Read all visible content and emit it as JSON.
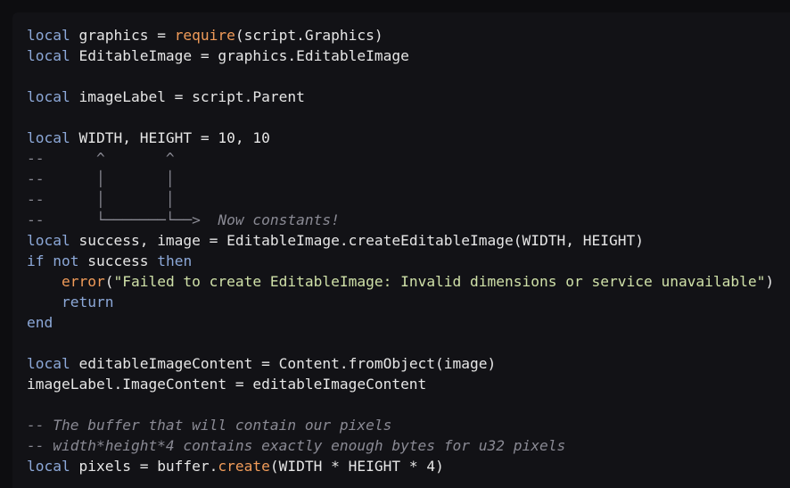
{
  "colors": {
    "background": "#0d0d10",
    "editor_background": "#121216",
    "text": "#e6e6e6",
    "keyword": "#8ca8d8",
    "function": "#f09b59",
    "string": "#cfe0a8",
    "comment": "#8a8a94"
  },
  "lines": [
    [
      [
        "kw",
        "local"
      ],
      [
        "id",
        " graphics = "
      ],
      [
        "fn",
        "require"
      ],
      [
        "id",
        "(script.Graphics)"
      ]
    ],
    [
      [
        "kw",
        "local"
      ],
      [
        "id",
        " EditableImage = graphics.EditableImage"
      ]
    ],
    [],
    [
      [
        "kw",
        "local"
      ],
      [
        "id",
        " imageLabel = script.Parent"
      ]
    ],
    [],
    [
      [
        "kw",
        "local"
      ],
      [
        "id",
        " WIDTH, HEIGHT = 10, 10"
      ]
    ],
    [
      [
        "cm",
        "--      ^       ^"
      ]
    ],
    [
      [
        "cm",
        "--      │       │"
      ]
    ],
    [
      [
        "cm",
        "--      │       │"
      ]
    ],
    [
      [
        "cm",
        "--      └───────└──>  "
      ],
      [
        "cmi",
        "Now constants!"
      ]
    ],
    [
      [
        "kw",
        "local"
      ],
      [
        "id",
        " success, image = EditableImage.createEditableImage(WIDTH, HEIGHT)"
      ]
    ],
    [
      [
        "kw",
        "if"
      ],
      [
        "id",
        " "
      ],
      [
        "kw",
        "not"
      ],
      [
        "id",
        " success "
      ],
      [
        "kw",
        "then"
      ]
    ],
    [
      [
        "id",
        "    "
      ],
      [
        "fn",
        "error"
      ],
      [
        "id",
        "("
      ],
      [
        "str",
        "\"Failed to create EditableImage: Invalid dimensions or service unavailable\""
      ],
      [
        "id",
        ")"
      ]
    ],
    [
      [
        "id",
        "    "
      ],
      [
        "kw",
        "return"
      ]
    ],
    [
      [
        "kw",
        "end"
      ]
    ],
    [],
    [
      [
        "kw",
        "local"
      ],
      [
        "id",
        " editableImageContent = Content.fromObject(image)"
      ]
    ],
    [
      [
        "id",
        "imageLabel.ImageContent = editableImageContent"
      ]
    ],
    [],
    [
      [
        "cmi",
        "-- The buffer that will contain our pixels"
      ]
    ],
    [
      [
        "cmi",
        "-- width*height*4 contains exactly enough bytes for u32 pixels"
      ]
    ],
    [
      [
        "kw",
        "local"
      ],
      [
        "id",
        " pixels = buffer."
      ],
      [
        "fn",
        "create"
      ],
      [
        "id",
        "(WIDTH * HEIGHT * 4)"
      ]
    ]
  ]
}
